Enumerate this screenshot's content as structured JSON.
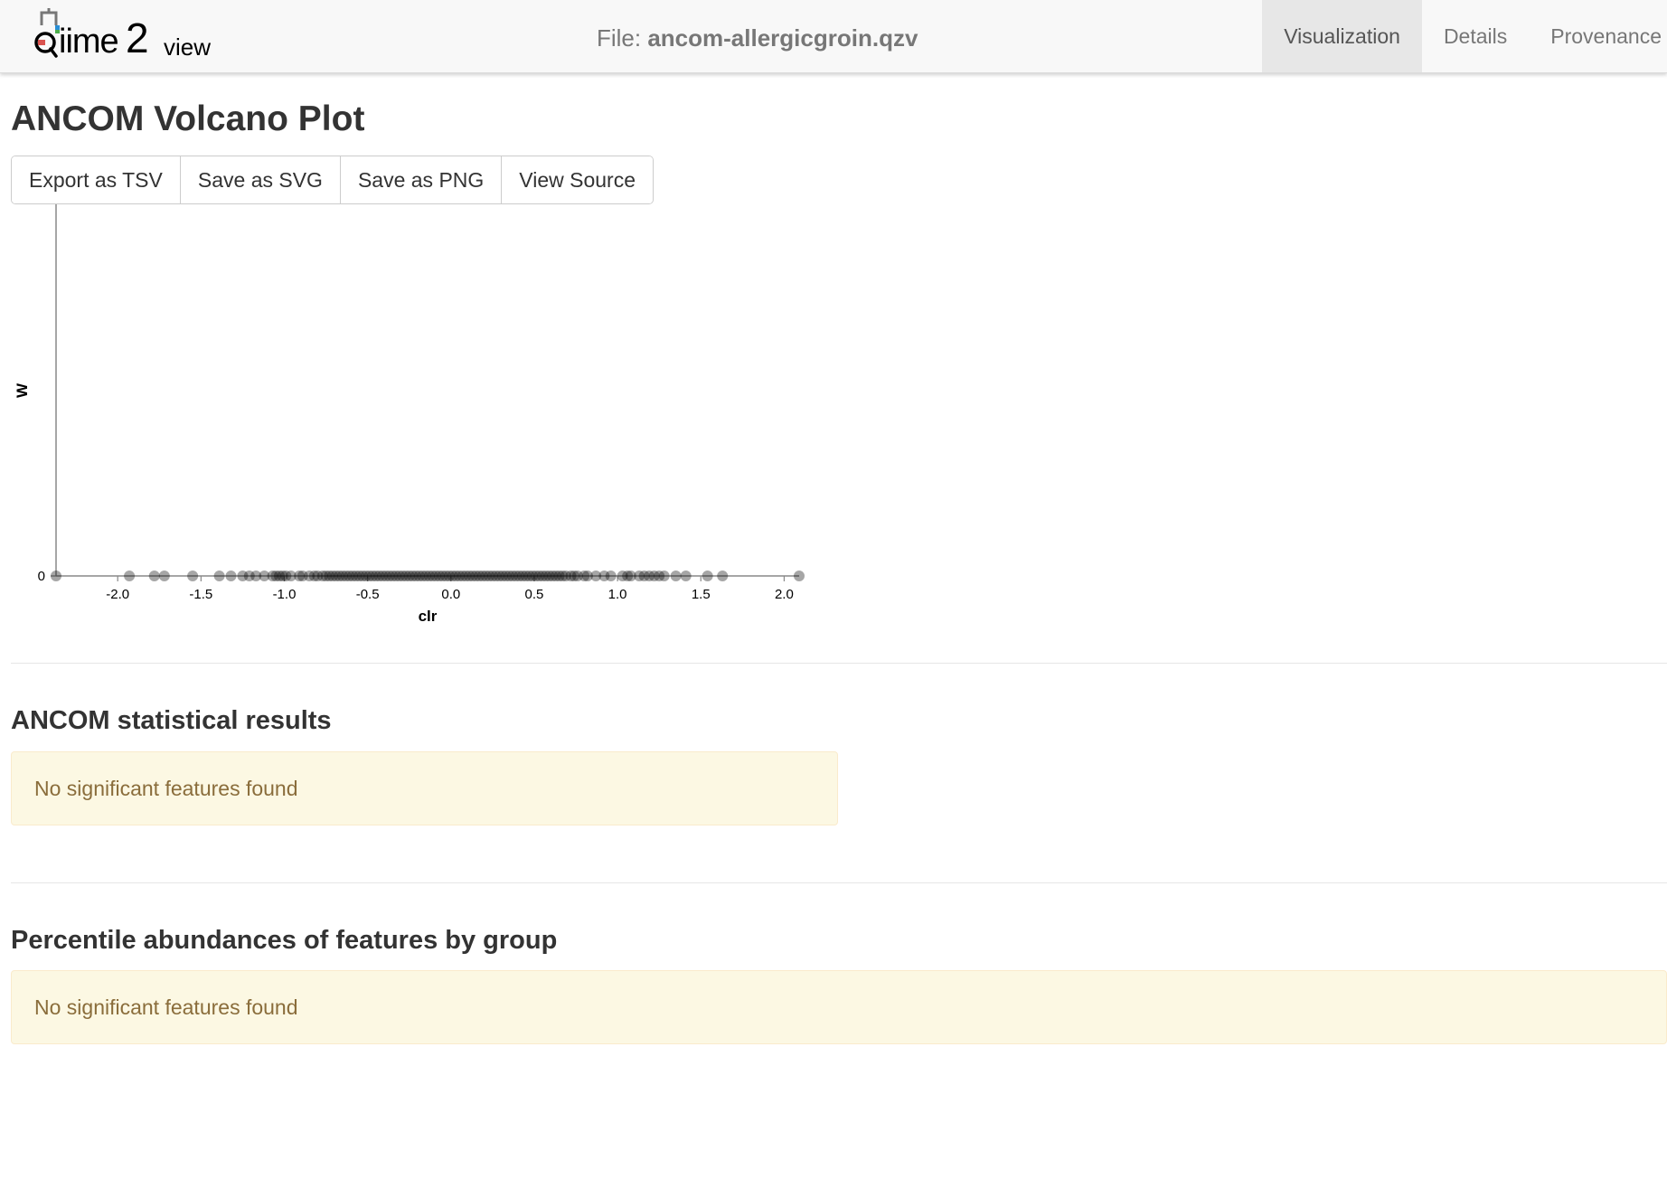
{
  "navbar": {
    "logo_text": "qiime2view",
    "file_label": "File: ",
    "file_name": "ancom-allergicgroin.qzv",
    "tabs": [
      {
        "label": "Visualization",
        "active": true
      },
      {
        "label": "Details",
        "active": false
      },
      {
        "label": "Provenance",
        "active": false
      }
    ]
  },
  "main": {
    "title": "ANCOM Volcano Plot",
    "buttons": [
      {
        "label": "Export as TSV"
      },
      {
        "label": "Save as SVG"
      },
      {
        "label": "Save as PNG"
      },
      {
        "label": "View Source"
      }
    ]
  },
  "sections": [
    {
      "heading": "ANCOM statistical results",
      "message": "No significant features found"
    },
    {
      "heading": "Percentile abundances of features by group",
      "message": "No significant features found"
    }
  ],
  "colors": {
    "point": "#000000",
    "alert_bg": "#fcf8e3",
    "alert_text": "#8a6d3b",
    "active_tab_bg": "#e7e7e7",
    "navbar_bg": "#f8f8f8"
  },
  "chart_data": {
    "type": "scatter",
    "title": "",
    "xlabel": "clr",
    "ylabel": "W",
    "xlim": [
      -2.37,
      2.09
    ],
    "ylim": [
      0,
      1
    ],
    "xticks": [
      -2.0,
      -1.5,
      -1.0,
      -0.5,
      0.0,
      0.5,
      1.0,
      1.5,
      2.0
    ],
    "xtick_labels": [
      "-2.0",
      "-1.5",
      "-1.0",
      "-0.5",
      "0.0",
      "0.5",
      "1.0",
      "1.5",
      "2.0"
    ],
    "yticks": [
      0
    ],
    "ytick_labels": [
      "0"
    ],
    "grid": false,
    "point_opacity": 0.35,
    "series": [
      {
        "x": [
          -2.37,
          -1.93,
          -1.78,
          -1.72,
          -1.55,
          -1.39,
          -1.32,
          -1.25,
          -1.21,
          -1.17,
          -1.12,
          -1.07,
          -1.05,
          -1.03,
          -1.01,
          -0.99,
          -0.96,
          -0.91,
          -0.89,
          -0.85,
          -0.82,
          -0.8,
          -0.77,
          -0.75,
          -0.73,
          -0.71,
          -0.69,
          -0.67,
          -0.65,
          -0.63,
          -0.61,
          -0.59,
          -0.57,
          -0.55,
          -0.53,
          -0.51,
          -0.49,
          -0.47,
          -0.45,
          -0.43,
          -0.41,
          -0.39,
          -0.37,
          -0.35,
          -0.33,
          -0.31,
          -0.29,
          -0.27,
          -0.25,
          -0.23,
          -0.21,
          -0.19,
          -0.17,
          -0.15,
          -0.13,
          -0.11,
          -0.09,
          -0.07,
          -0.05,
          -0.03,
          -0.01,
          0.01,
          0.03,
          0.05,
          0.07,
          0.09,
          0.11,
          0.13,
          0.15,
          0.17,
          0.19,
          0.21,
          0.23,
          0.25,
          0.27,
          0.29,
          0.31,
          0.33,
          0.35,
          0.37,
          0.39,
          0.41,
          0.43,
          0.45,
          0.47,
          0.49,
          0.51,
          0.53,
          0.55,
          0.57,
          0.59,
          0.61,
          0.63,
          0.65,
          0.67,
          0.69,
          0.72,
          0.74,
          0.76,
          0.8,
          0.82,
          0.87,
          0.92,
          0.96,
          1.03,
          1.06,
          1.08,
          1.13,
          1.16,
          1.19,
          1.22,
          1.25,
          1.28,
          1.35,
          1.41,
          1.54,
          1.63,
          2.09
        ],
        "y": [
          0,
          0,
          0,
          0,
          0,
          0,
          0,
          0,
          0,
          0,
          0,
          0,
          0,
          0,
          0,
          0,
          0,
          0,
          0,
          0,
          0,
          0,
          0,
          0,
          0,
          0,
          0,
          0,
          0,
          0,
          0,
          0,
          0,
          0,
          0,
          0,
          0,
          0,
          0,
          0,
          0,
          0,
          0,
          0,
          0,
          0,
          0,
          0,
          0,
          0,
          0,
          0,
          0,
          0,
          0,
          0,
          0,
          0,
          0,
          0,
          0,
          0,
          0,
          0,
          0,
          0,
          0,
          0,
          0,
          0,
          0,
          0,
          0,
          0,
          0,
          0,
          0,
          0,
          0,
          0,
          0,
          0,
          0,
          0,
          0,
          0,
          0,
          0,
          0,
          0,
          0,
          0,
          0,
          0,
          0,
          0,
          0,
          0,
          0,
          0,
          0,
          0,
          0,
          0,
          0,
          0,
          0,
          0,
          0,
          0,
          0,
          0,
          0,
          0,
          0,
          0,
          0,
          0
        ]
      }
    ]
  }
}
